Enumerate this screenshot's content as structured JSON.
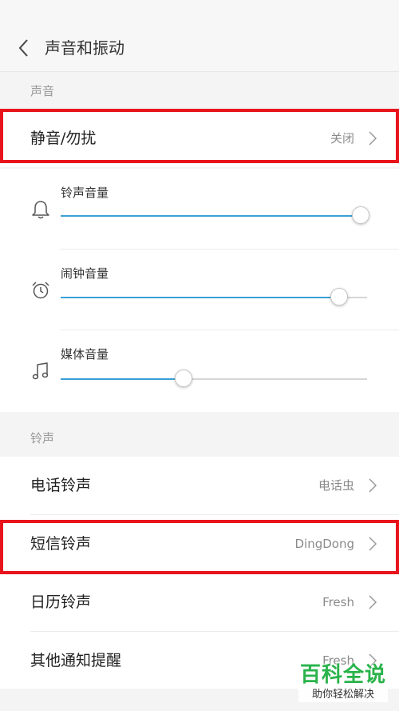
{
  "header": {
    "title": "声音和振动",
    "back_icon": "chevron-left-icon"
  },
  "sections": {
    "sound": {
      "label": "声音",
      "mute": {
        "title": "静音/勿扰",
        "value": "关闭"
      },
      "volumes": [
        {
          "label": "铃声音量",
          "icon": "bell-icon",
          "level_percent": 98
        },
        {
          "label": "闹钟音量",
          "icon": "alarm-clock-icon",
          "level_percent": 91
        },
        {
          "label": "媒体音量",
          "icon": "music-note-icon",
          "level_percent": 40
        }
      ]
    },
    "ringtones": {
      "label": "铃声",
      "items": [
        {
          "title": "电话铃声",
          "value": "电话虫"
        },
        {
          "title": "短信铃声",
          "value": "DingDong"
        },
        {
          "title": "日历铃声",
          "value": "Fresh"
        },
        {
          "title": "其他通知提醒",
          "value": "Fresh"
        }
      ]
    }
  },
  "colors": {
    "accent": "#3aa0d6",
    "highlight": "#e8141c",
    "watermark": "#2ab34a"
  },
  "watermark": {
    "title": "百科全说",
    "subtitle": "助你轻松解决"
  }
}
